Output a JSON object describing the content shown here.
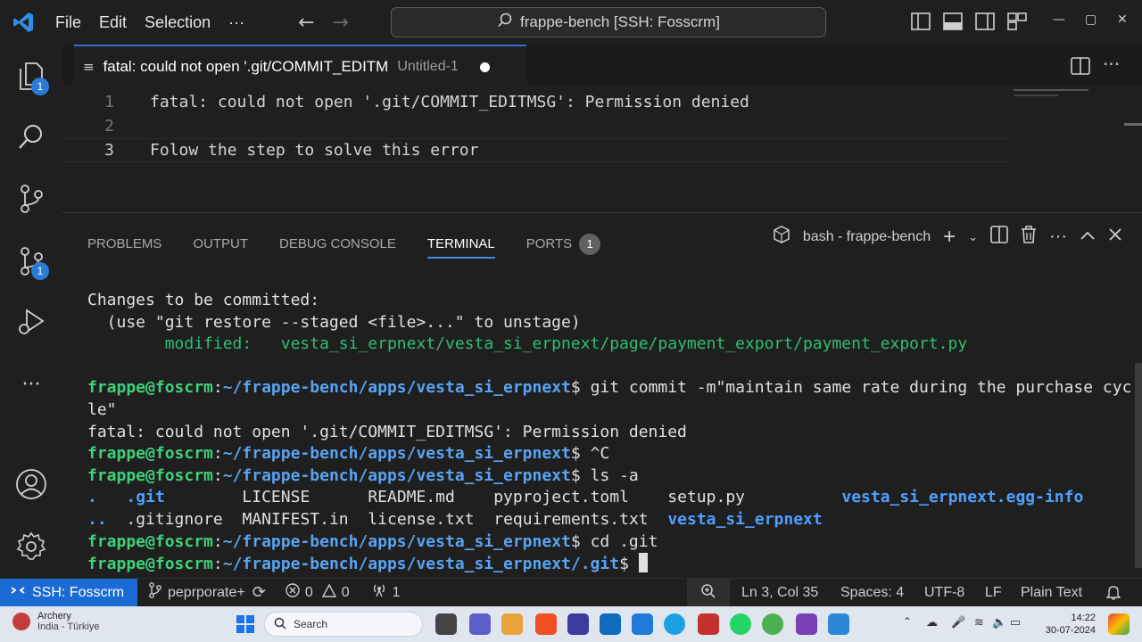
{
  "menu": {
    "file": "File",
    "edit": "Edit",
    "selection": "Selection",
    "more": "···"
  },
  "command_center": {
    "text": "frappe-bench [SSH: Fosscrm]"
  },
  "activity": {
    "explorer_badge": "1",
    "scm_badge": "1"
  },
  "tab": {
    "title": "fatal: could not open '.git/COMMIT_EDITM",
    "subtitle": "Untitled-1"
  },
  "editor": {
    "lines": [
      {
        "num": "1",
        "text": "fatal: could not open '.git/COMMIT_EDITMSG': Permission denied"
      },
      {
        "num": "2",
        "text": ""
      },
      {
        "num": "3",
        "text": "Folow the step to solve this error"
      }
    ]
  },
  "panel": {
    "tabs": [
      "PROBLEMS",
      "OUTPUT",
      "DEBUG CONSOLE",
      "TERMINAL",
      "PORTS"
    ],
    "ports_badge": "1",
    "terminal_name": "bash - frappe-bench"
  },
  "terminal": {
    "changes_header": "Changes to be committed:",
    "restore_hint": "  (use \"git restore --staged <file>...\" to unstage)",
    "modified_label": "        modified:   ",
    "modified_path": "vesta_si_erpnext/vesta_si_erpnext/page/payment_export/payment_export.py",
    "user_host": "frappe@foscrm",
    "colon": ":",
    "path_app": "~/frappe-bench/apps/vesta_si_erpnext",
    "path_git": "~/frappe-bench/apps/vesta_si_erpnext/.git",
    "dollar": "$ ",
    "cmd_commit": "git commit -m\"maintain same rate during the purchase cyc",
    "cmd_commit_wrap": "le\"",
    "fatal": "fatal: could not open '.git/COMMIT_EDITMSG': Permission denied",
    "cmd_ctrl_c": "^C",
    "cmd_ls": "ls -a",
    "ls_row1": [
      ".",
      ".git",
      "LICENSE",
      "README.md",
      "pyproject.toml",
      "setup.py",
      "vesta_si_erpnext.egg-info"
    ],
    "ls_row2": [
      "..",
      ".gitignore",
      "MANIFEST.in",
      "license.txt",
      "requirements.txt",
      "vesta_si_erpnext"
    ],
    "cmd_cd": "cd .git"
  },
  "status": {
    "remote": "SSH: Fosscrm",
    "branch": "peprporate+",
    "errors": "0",
    "warnings": "0",
    "ports": "1",
    "position": "Ln 3, Col 35",
    "spaces": "Spaces: 4",
    "encoding": "UTF-8",
    "eol": "LF",
    "language": "Plain Text"
  },
  "taskbar": {
    "weather_title": "Archery",
    "weather_sub": "India - Türkiye",
    "search": "Search",
    "time": "14:22",
    "date": "30-07-2024"
  },
  "colors": {
    "accent": "#2f6fd4",
    "remote_bg": "#1c6bd4",
    "prompt_green": "#3fd17a",
    "prompt_path": "#5aa3f0"
  }
}
